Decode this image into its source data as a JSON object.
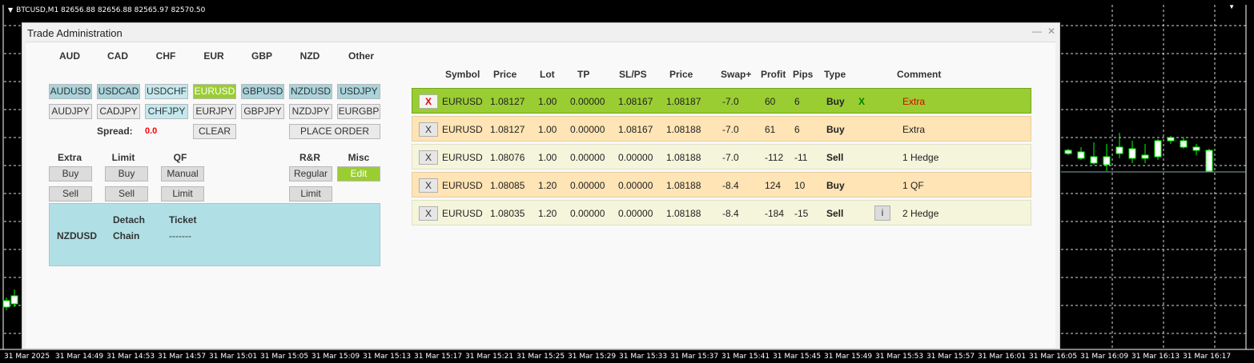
{
  "chart": {
    "symbol_info": "BTCUSD,M1  82656.88 82656.88 82565.97 82570.50",
    "time_labels": [
      "31 Mar 2025",
      "31 Mar 14:49",
      "31 Mar 14:53",
      "31 Mar 14:57",
      "31 Mar 15:01",
      "31 Mar 15:05",
      "31 Mar 15:09",
      "31 Mar 15:13",
      "31 Mar 15:17",
      "31 Mar 15:21",
      "31 Mar 15:25",
      "31 Mar 15:29",
      "31 Mar 15:33",
      "31 Mar 15:37",
      "31 Mar 15:41",
      "31 Mar 15:45",
      "31 Mar 15:49",
      "31 Mar 15:53",
      "31 Mar 15:57",
      "31 Mar 16:01",
      "31 Mar 16:05",
      "31 Mar 16:09",
      "31 Mar 16:13",
      "31 Mar 16:17"
    ],
    "colors": {
      "background": "#000000",
      "candle": "#00ff00",
      "grid": "#ffffff"
    }
  },
  "window": {
    "title": "Trade Administration",
    "minimize": "—",
    "close": "✕"
  },
  "currency_headers": [
    "AUD",
    "CAD",
    "CHF",
    "EUR",
    "GBP",
    "NZD",
    "Other"
  ],
  "pair_row1": [
    "AUDUSD",
    "USDCAD",
    "USDCHF",
    "EURUSD",
    "GBPUSD",
    "NZDUSD",
    "USDJPY"
  ],
  "pair_row2": [
    "AUDJPY",
    "CADJPY",
    "CHFJPY",
    "EURJPY",
    "GBPJPY",
    "NZDJPY",
    "EURGBP"
  ],
  "spread": {
    "label": "Spread:",
    "value": "0.0"
  },
  "clear_label": "CLEAR",
  "place_order_label": "PLACE ORDER",
  "groups": {
    "extra": {
      "header": "Extra",
      "buy": "Buy",
      "sell": "Sell"
    },
    "limit": {
      "header": "Limit",
      "buy": "Buy",
      "sell": "Sell"
    },
    "qf": {
      "header": "QF",
      "manual": "Manual",
      "limit": "Limit"
    },
    "rr": {
      "header": "R&R",
      "regular": "Regular",
      "limit": "Limit"
    },
    "misc": {
      "header": "Misc",
      "edit": "Edit"
    }
  },
  "info": {
    "detach_header": "Detach",
    "ticket_header": "Ticket",
    "pair": "NZDUSD",
    "chain": "Chain",
    "ticket": "-------"
  },
  "table": {
    "headers": [
      "Symbol",
      "Price",
      "Lot",
      "TP",
      "SL/PS",
      "Price",
      "Swap+",
      "Profit",
      "Pips",
      "Type",
      "Comment"
    ],
    "rows": [
      {
        "close": "X",
        "symbol": "EURUSD",
        "price": "1.08127",
        "lot": "1.00",
        "tp": "0.00000",
        "sl": "1.08167",
        "cur": "1.08187",
        "swap": "-7.0",
        "profit": "60",
        "pips": "6",
        "type": "Buy",
        "flag": "X",
        "info": "",
        "comment": "Extra"
      },
      {
        "close": "X",
        "symbol": "EURUSD",
        "price": "1.08127",
        "lot": "1.00",
        "tp": "0.00000",
        "sl": "1.08167",
        "cur": "1.08188",
        "swap": "-7.0",
        "profit": "61",
        "pips": "6",
        "type": "Buy",
        "flag": "",
        "info": "",
        "comment": "Extra"
      },
      {
        "close": "X",
        "symbol": "EURUSD",
        "price": "1.08076",
        "lot": "1.00",
        "tp": "0.00000",
        "sl": "0.00000",
        "cur": "1.08188",
        "swap": "-7.0",
        "profit": "-112",
        "pips": "-11",
        "type": "Sell",
        "flag": "",
        "info": "",
        "comment": "1 Hedge"
      },
      {
        "close": "X",
        "symbol": "EURUSD",
        "price": "1.08085",
        "lot": "1.20",
        "tp": "0.00000",
        "sl": "0.00000",
        "cur": "1.08188",
        "swap": "-8.4",
        "profit": "124",
        "pips": "10",
        "type": "Buy",
        "flag": "",
        "info": "",
        "comment": "1 QF"
      },
      {
        "close": "X",
        "symbol": "EURUSD",
        "price": "1.08035",
        "lot": "1.20",
        "tp": "0.00000",
        "sl": "0.00000",
        "cur": "1.08188",
        "swap": "-8.4",
        "profit": "-184",
        "pips": "-15",
        "type": "Sell",
        "flag": "",
        "info": "i",
        "comment": "2 Hedge"
      }
    ]
  }
}
